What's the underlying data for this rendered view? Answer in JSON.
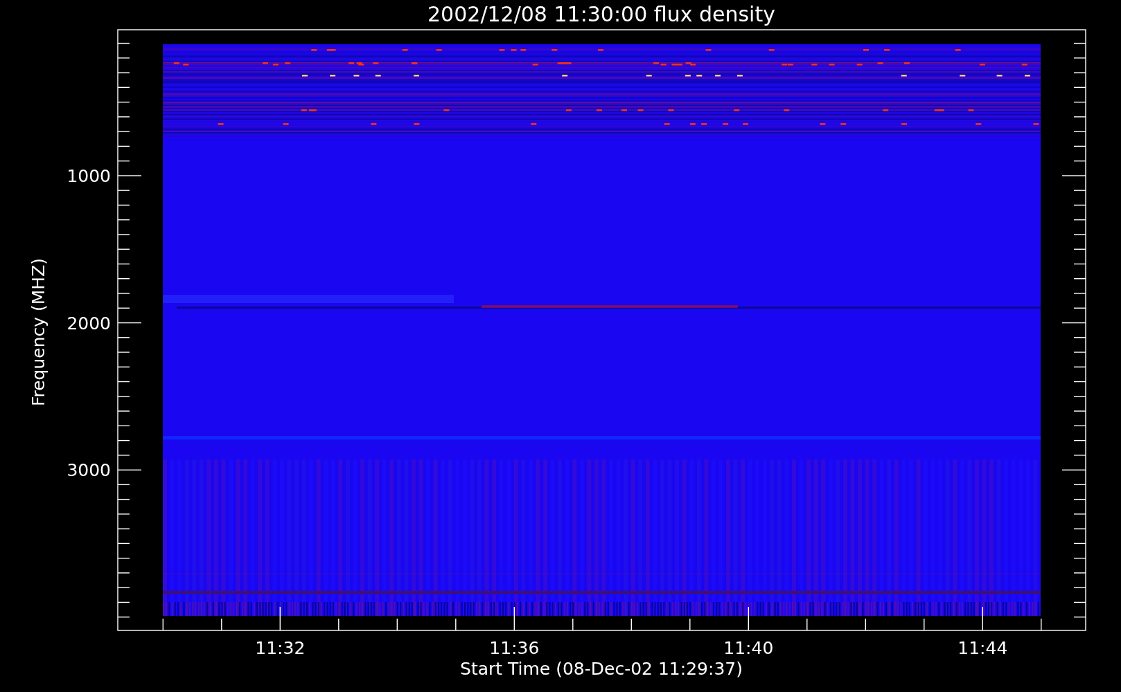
{
  "plot": {
    "title": "2002/12/08 11:30:00 flux density",
    "x_axis": {
      "label": "Start Time (08-Dec-02 11:29:37)",
      "tick_labels": [
        "11:32",
        "11:36",
        "11:40",
        "11:44"
      ]
    },
    "y_axis": {
      "label": "Frequency (MHZ)",
      "tick_labels": [
        "1000",
        "2000",
        "3000"
      ]
    }
  }
}
